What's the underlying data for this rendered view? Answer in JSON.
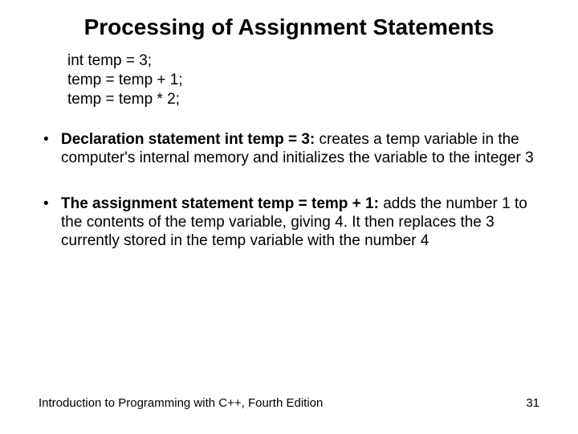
{
  "title": "Processing of Assignment Statements",
  "code": {
    "line1": "int temp = 3;",
    "line2": "temp = temp + 1;",
    "line3": "temp = temp * 2;"
  },
  "bullets": {
    "b1": {
      "lead": "Declaration statement int temp = 3:",
      "rest": " creates a temp variable in the computer's internal memory and initializes the variable to the integer 3"
    },
    "b2": {
      "lead": "The assignment statement temp = temp + 1:",
      "rest": " adds the number 1 to the contents of the temp variable, giving 4. It then replaces the 3 currently stored in the temp variable with the number 4"
    }
  },
  "footer": {
    "left": "Introduction to Programming with C++, Fourth Edition",
    "right": "31"
  }
}
